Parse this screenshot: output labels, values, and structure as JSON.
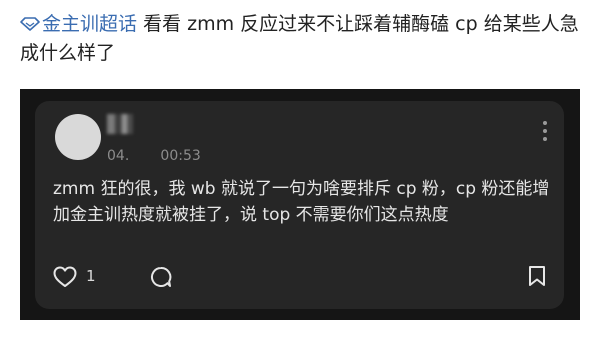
{
  "header": {
    "topic_tag": "金主训超话",
    "title": "看看 zmm 反应过来不让踩着辅酶磕 cp 给某些人急成什么样了",
    "topic_icon": "diamond-topic-icon",
    "accent_color": "#3b6db1"
  },
  "post": {
    "meta": "04.       00:53",
    "text": "zmm 狂的很，我 wb 就说了一句为啥要排斥 cp 粉，cp 粉还能增加金主训热度就被挂了，说 top 不需要你们这点热度",
    "like_count": "1",
    "icons": [
      "avatar",
      "more-vertical-icon",
      "heart-icon",
      "comment-icon",
      "bookmark-icon"
    ]
  }
}
